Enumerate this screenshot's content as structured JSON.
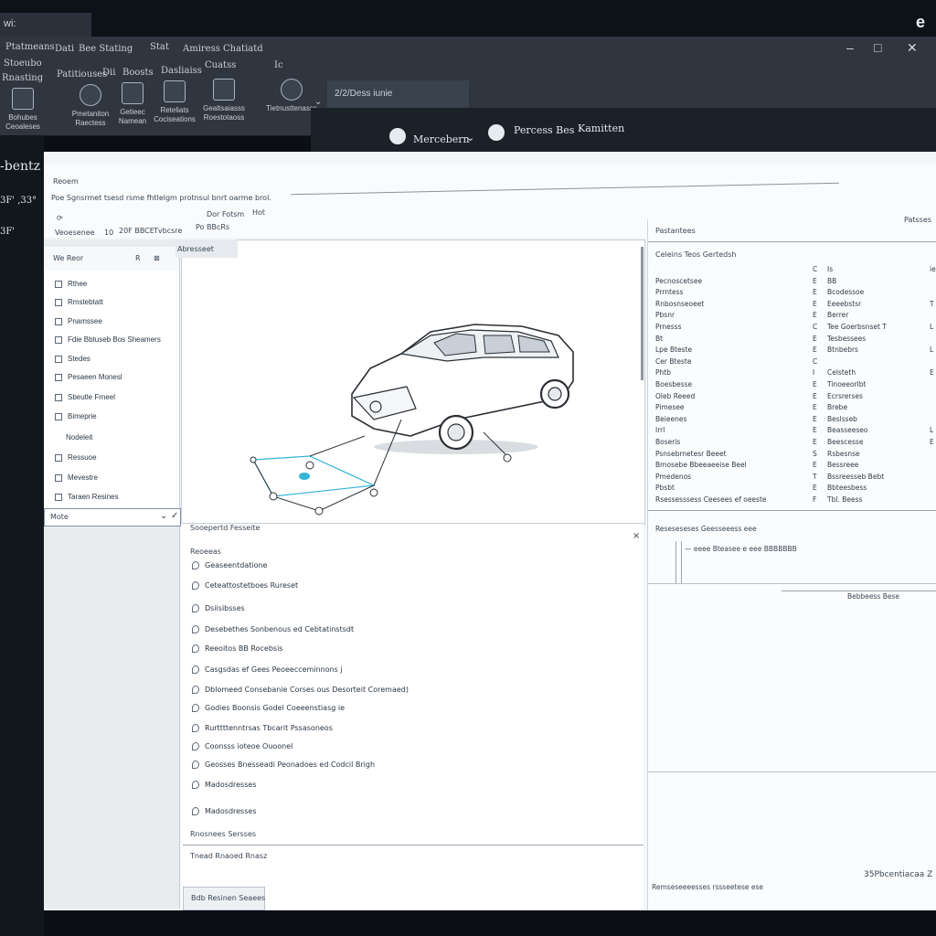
{
  "window": {
    "tab_title": "wi:",
    "minimize": "–",
    "maximize": "□",
    "close": "✕",
    "corner_label": "e"
  },
  "ribbon": {
    "menu_row1": [
      "Ptatmeans",
      "Dati",
      "Bee Stating",
      "Stat",
      "Amiress",
      "Chatiatd"
    ],
    "menu_row2": [
      "Stoeubo",
      "Rnasting"
    ],
    "menu_row3": [
      "Patitiouses",
      "Dii",
      "Boosts",
      "Dasliaiss",
      "Cuatss",
      "Ic"
    ],
    "buttons": [
      {
        "label": "Bohubes\nCeoaleses",
        "icon": "document-icon"
      },
      {
        "label": "Pmetaniton\nRaectess",
        "icon": "gear-icon"
      },
      {
        "label": "Getieec\nNamean",
        "icon": "file-icon"
      },
      {
        "label": "Reteliats\nCociseations",
        "icon": "chart-icon"
      },
      {
        "label": "Gealtsaiasss\nRoestotaoss",
        "icon": "image-icon"
      },
      {
        "label": "Tietnusttenasss",
        "icon": "car-icon"
      }
    ],
    "search_text": "2/2/Dess  iunie"
  },
  "brand": {
    "left_name": "Mercebern",
    "right_name": "Percess Bes",
    "right_suffix": "Kamitten"
  },
  "leftstrip": {
    "title": "-bentz",
    "code": "3F' ,33°",
    "mark": "3F'"
  },
  "doc": {
    "header_label": "Reoem",
    "instruction": "Poe Sgnsrmet tsesd rsme fhtlelgm protnsul bnrt oarme brol.",
    "toolbar_items": [
      "Veoesenee",
      "10",
      "20F BBCE",
      "Tvbcsre",
      "Po BBcRs"
    ],
    "toolbar_right": [
      "Dor Fotsm",
      "Hot"
    ]
  },
  "tree": {
    "header": "We Reor",
    "header_icons": [
      "R",
      "⊠"
    ],
    "items": [
      "Rthee",
      "Rmstebtatt",
      "Pnamssee",
      "Fdie Bbtuseb Bos Sheamers",
      "Stedes",
      "Pesaeen Monesl",
      "Sbeutle Frneel",
      "Bimeprie",
      "Nodeleit",
      "Ressuoe",
      "Mevestre",
      "Taraen Resines"
    ],
    "select_value": "Mote"
  },
  "viewer": {
    "tab_label": "Abresseet"
  },
  "listpanel": {
    "header": "Sooepertd Fesseite",
    "sub_header": "Reoeeas",
    "items": [
      "Geaseentdatione",
      "Ceteattostetboes Rureset",
      "Dsiisibsses",
      "Desebethes Sonbenous ed Cebtatinstsdt",
      "Reeoitos BB Rocebsis",
      "Casgsdas ef Gees Peoeecceminnons j",
      "Dblomeed Consebanie Corses ous Desorteit Coremaed)",
      "Godies Boonsis Godel Coeeenstiasg ie",
      "Rurttttenntrsas Tbcarit Pssasoneos",
      "Coonsss ioteoe Ouoonel",
      "Geosses Bnesseadi Peonadoes ed Codcil Brigh",
      "Madosdresses"
    ],
    "footer_label": "Rnosnees Sersses",
    "footer_label2": "Tnead Rnaoed Rnasz",
    "bottom_button": "Bdb Resinen Seaees"
  },
  "rightpanel": {
    "header": "Pastantees",
    "header_right": "Patsses",
    "section_title": "Celeins Teos Gertedsh",
    "rows": [
      {
        "name": "",
        "num": "C",
        "val": "Is",
        "flag": "ie"
      },
      {
        "name": "Pecnoscetsee",
        "num": "E",
        "val": "BB",
        "flag": ""
      },
      {
        "name": "Prrntess",
        "num": "E",
        "val": "Bcodessoe",
        "flag": ""
      },
      {
        "name": "Rnbosnseoeet",
        "num": "E",
        "val": "Eeeebstsr",
        "flag": "T"
      },
      {
        "name": "Pbsnr",
        "num": "E",
        "val": "Berrer",
        "flag": ""
      },
      {
        "name": "Prnesss",
        "num": "C",
        "val": "Tee Goerbsnset T",
        "flag": "L"
      },
      {
        "name": "Bt",
        "num": "E",
        "val": "Tesbessees",
        "flag": ""
      },
      {
        "name": "Lpe  Bteste",
        "num": "E",
        "val": "Btnbebrs",
        "flag": "L"
      },
      {
        "name": "Cer  Bteste",
        "num": "C",
        "val": "",
        "flag": ""
      },
      {
        "name": "Phtb",
        "num": "I",
        "val": "Celsteth",
        "flag": "E"
      },
      {
        "name": "Boesbesse",
        "num": "E",
        "val": "Tinoeeorlbt",
        "flag": ""
      },
      {
        "name": "Oleb Reeed",
        "num": "E",
        "val": "Ecrsrerses",
        "flag": ""
      },
      {
        "name": "Pimesee",
        "num": "E",
        "val": "Brebe",
        "flag": ""
      },
      {
        "name": "Beieenes",
        "num": "E",
        "val": "Beslsseb",
        "flag": ""
      },
      {
        "name": "Irrl",
        "num": "E",
        "val": "Beasseeseo",
        "flag": "L"
      },
      {
        "name": "Boseris",
        "num": "E",
        "val": "Beescesse",
        "flag": "E"
      },
      {
        "name": "Psnsebrnetesr Beeet",
        "num": "S",
        "val": "Rsbesnse",
        "flag": ""
      },
      {
        "name": "Bmosebe Bbeeaeeise Beel",
        "num": "E",
        "val": "Bessreee",
        "flag": ""
      },
      {
        "name": "Pmedenos",
        "num": "T",
        "val": "Bssreesseb Bebt",
        "flag": ""
      },
      {
        "name": "Pbsbt",
        "num": "E",
        "val": "Bbteesbess",
        "flag": ""
      },
      {
        "name": "Rsessesssess Ceesees ef oeeste",
        "num": "F",
        "val": "Tbl. Beess",
        "flag": ""
      }
    ],
    "lower_title": "Reseseseses Geesseeess eee",
    "lower_note": "— eeee  Bteasee  e eee BBBBBBB",
    "lower_footer": "Bebbeess Bese",
    "footer_left": "Remseseeeesses rssseetese ese",
    "footer_right": "35Pbcentiacaa Z"
  }
}
